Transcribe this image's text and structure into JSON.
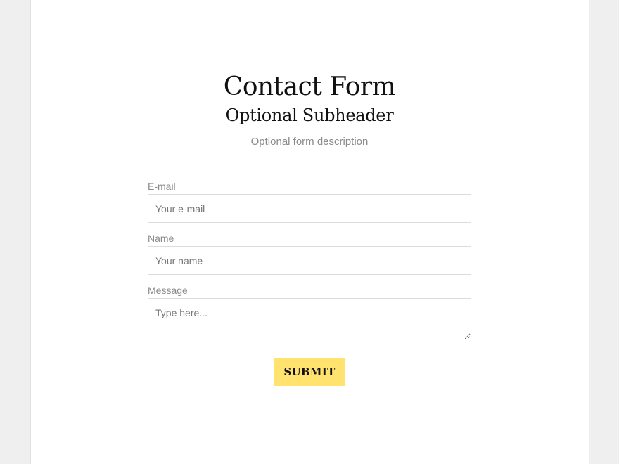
{
  "form": {
    "title": "Contact Form",
    "subheader": "Optional Subheader",
    "description": "Optional form description",
    "fields": {
      "email": {
        "label": "E-mail",
        "placeholder": "Your e-mail",
        "value": ""
      },
      "name": {
        "label": "Name",
        "placeholder": "Your name",
        "value": ""
      },
      "message": {
        "label": "Message",
        "placeholder": "Type here...",
        "value": ""
      }
    },
    "submit_label": "SUBMIT"
  },
  "colors": {
    "background": "#efefef",
    "card": "#ffffff",
    "submit_button": "#ffe36e",
    "label_text": "#8a8a8a",
    "field_border": "#dcdcdc"
  }
}
